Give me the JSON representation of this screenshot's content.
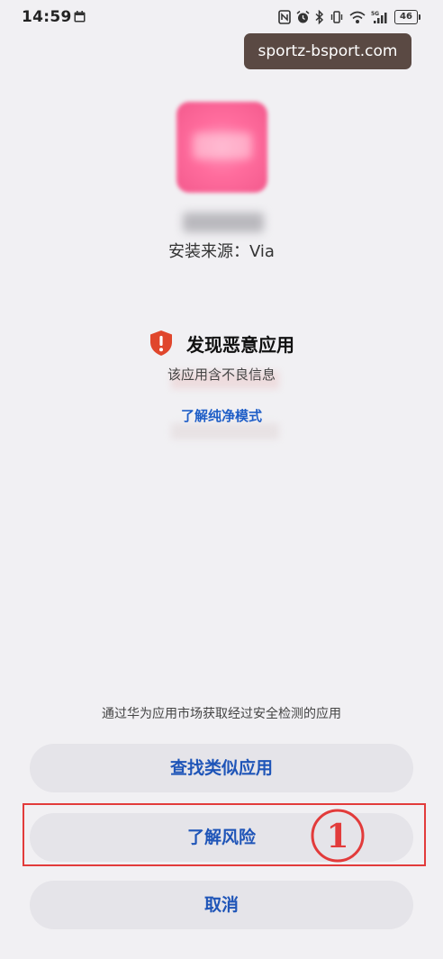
{
  "status_bar": {
    "time": "14:59",
    "battery": "46"
  },
  "watermark": "sportz-bsport.com",
  "app": {
    "install_source": "安装来源：Via"
  },
  "warning": {
    "title": "发现恶意应用",
    "description": "该应用含不良信息",
    "link": "了解纯净模式"
  },
  "footer": {
    "note": "通过华为应用市场获取经过安全检测的应用"
  },
  "buttons": {
    "find_similar": "查找类似应用",
    "learn_risk": "了解风险",
    "cancel": "取消"
  },
  "annotation": {
    "step": "1"
  },
  "colors": {
    "accent": "#1f55b8",
    "warning": "#e0462c",
    "highlight": "#e23b3b",
    "background": "#f1f0f3"
  }
}
